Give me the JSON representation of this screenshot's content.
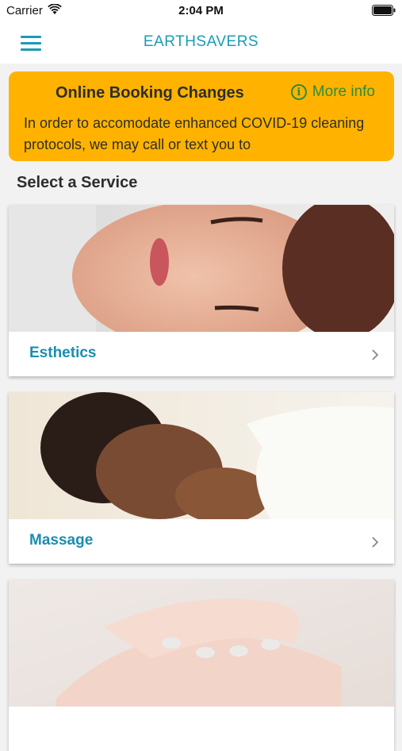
{
  "status": {
    "carrier": "Carrier",
    "time": "2:04 PM"
  },
  "nav": {
    "title": "EARTHSAVERS"
  },
  "banner": {
    "title": "Online Booking Changes",
    "more_info": "More info",
    "info_glyph": "i",
    "body": "In order to accomodate enhanced COVID-19 cleaning protocols, we may call or text you to"
  },
  "section": {
    "title": "Select a Service"
  },
  "services": [
    {
      "label": "Esthetics"
    },
    {
      "label": "Massage"
    }
  ],
  "colors": {
    "accent": "#1a9cb5",
    "banner": "#ffb300",
    "info": "#2e8b3d"
  }
}
